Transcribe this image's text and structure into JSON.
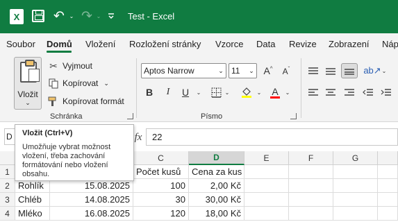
{
  "window": {
    "title": "Test  -  Excel",
    "app_logo": "X",
    "brand_color": "#107c41"
  },
  "quick_access": {
    "icons": [
      "excel-logo-icon",
      "save-icon",
      "undo-icon",
      "redo-icon",
      "more-icon"
    ],
    "undo_glyph": "↶",
    "redo_glyph": "↷",
    "dropdown_glyph": "⌄"
  },
  "ribbon_tabs": [
    "Soubor",
    "Domů",
    "Vložení",
    "Rozložení stránky",
    "Vzorce",
    "Data",
    "Revize",
    "Zobrazení",
    "Náp"
  ],
  "active_tab": "Domů",
  "clipboard": {
    "label": "Schránka",
    "paste": "Vložit",
    "cut": "Vyjmout",
    "copy": "Kopírovat",
    "format_painter": "Kopírovat formát"
  },
  "font": {
    "label": "Písmo",
    "family": "Aptos Narrow",
    "size": "11",
    "grow": "A^",
    "shrink": "Aˇ",
    "bold": "B",
    "italic": "I",
    "underline": "U",
    "fill_color": "#ffff00",
    "font_color": "#ff0000",
    "font_color_glyph": "A"
  },
  "formula_bar": {
    "name_box_partial": "D",
    "fx": "fx",
    "value": "22"
  },
  "sheet": {
    "column_headers": [
      "C",
      "D",
      "E",
      "F",
      "G"
    ],
    "selected_column": "D",
    "row_headers": [
      "1",
      "2",
      "3",
      "4"
    ],
    "rows": [
      {
        "a": "",
        "b": "",
        "c": "Počet kusů",
        "d": "Cena za kus"
      },
      {
        "a": "Rohlík",
        "b": "15.08.2025",
        "c": "100",
        "d": "2,00 Kč"
      },
      {
        "a": "Chléb",
        "b": "14.08.2025",
        "c": "30",
        "d": "30,00 Kč"
      },
      {
        "a": "Mléko",
        "b": "16.08.2025",
        "c": "120",
        "d": "18,00 Kč"
      }
    ]
  },
  "tooltip": {
    "title": "Vložit (Ctrl+V)",
    "description": "Umožňuje vybrat možnost vložení, třeba zachování formátování nebo vložení obsahu."
  }
}
